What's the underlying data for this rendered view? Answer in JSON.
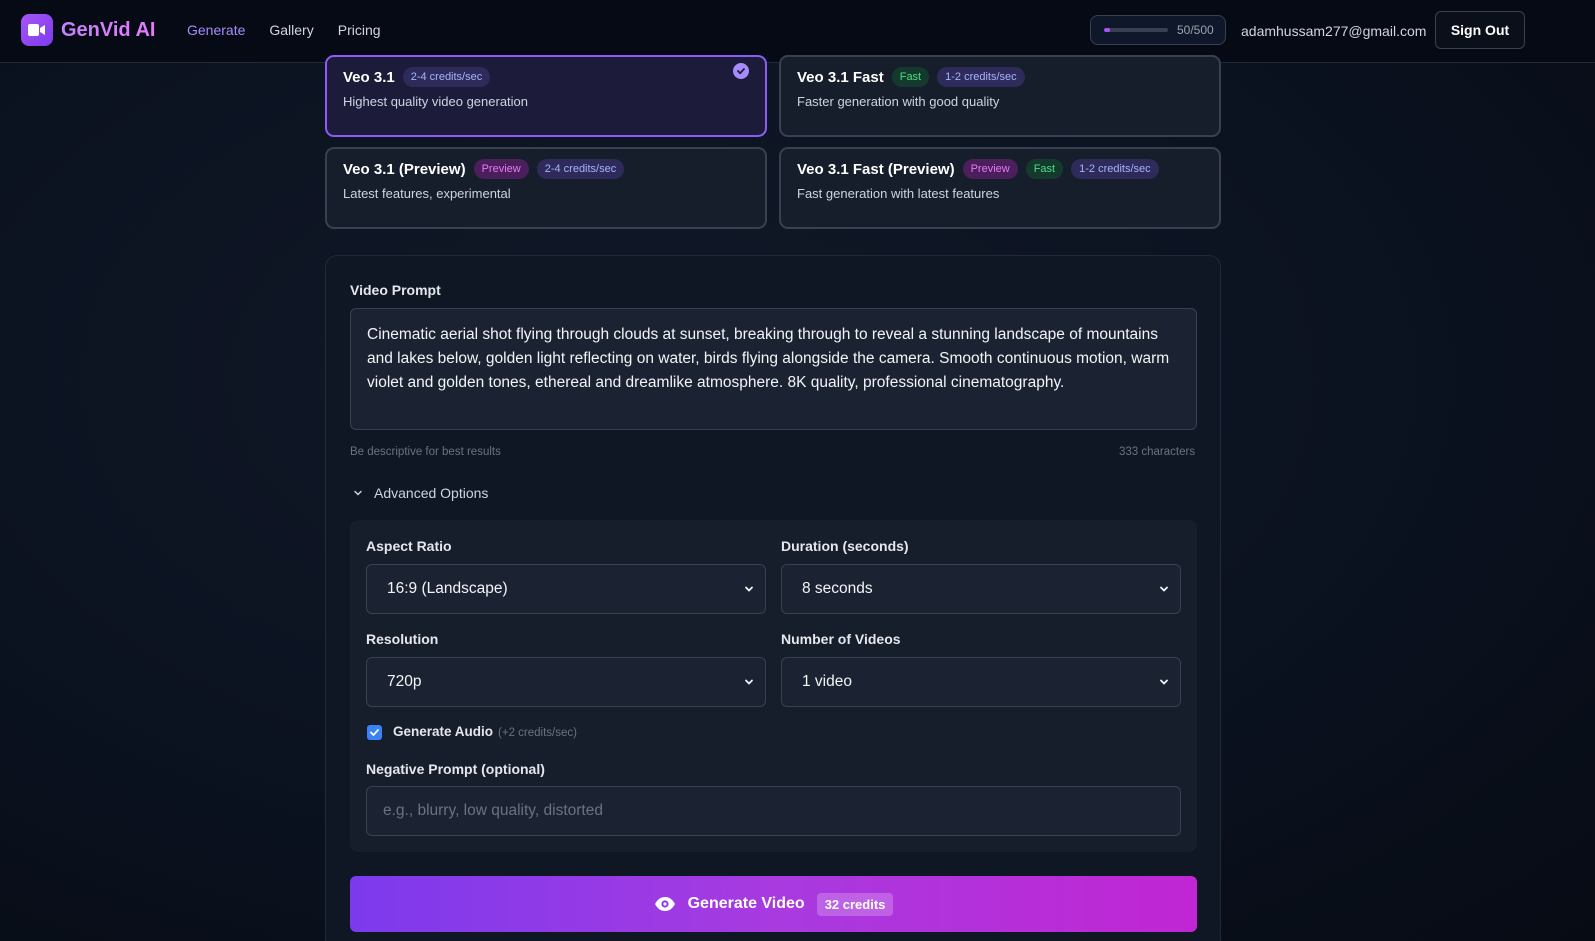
{
  "header": {
    "app_name": "GenVid AI",
    "nav": [
      "Generate",
      "Gallery",
      "Pricing"
    ],
    "credits_used": 50,
    "credits_text": "50/500",
    "email": "adamhussam277@gmail.com",
    "sign_out": "Sign Out"
  },
  "models": [
    {
      "title": "Veo 3.1",
      "badges": [
        "2-4 credits/sec"
      ],
      "desc": "Highest quality video generation",
      "selected": true
    },
    {
      "title": "Veo 3.1 Fast",
      "badges": [
        "Fast",
        "1-2 credits/sec"
      ],
      "desc": "Faster generation with good quality"
    },
    {
      "title": "Veo 3.1 (Preview)",
      "badges": [
        "Preview",
        "2-4 credits/sec"
      ],
      "desc": "Latest features, experimental"
    },
    {
      "title": "Veo 3.1 Fast (Preview)",
      "badges": [
        "Preview",
        "Fast",
        "1-2 credits/sec"
      ],
      "desc": "Fast generation with latest features"
    }
  ],
  "prompt": {
    "label": "Video Prompt",
    "value": "Cinematic aerial shot flying through clouds at sunset, breaking through to reveal a stunning landscape of mountains and lakes below, golden light reflecting on water, birds flying alongside the camera. Smooth continuous motion, warm violet and golden tones, ethereal and dreamlike atmosphere. 8K quality, professional cinematography.",
    "hint": "Be descriptive for best results",
    "char_count": "333 characters"
  },
  "advanced": {
    "toggle_label": "Advanced Options",
    "aspect_label": "Aspect Ratio",
    "aspect_value": "16:9 (Landscape)",
    "duration_label": "Duration (seconds)",
    "duration_value": "8 seconds",
    "resolution_label": "Resolution",
    "resolution_value": "720p",
    "count_label": "Number of Videos",
    "count_value": "1 video",
    "audio_label": "Generate Audio",
    "audio_sub": "(+2 credits/sec)",
    "negative_label": "Negative Prompt (optional)",
    "negative_placeholder": "e.g., blurry, low quality, distorted"
  },
  "generate": {
    "label": "Generate Video",
    "credits": "32 credits"
  }
}
